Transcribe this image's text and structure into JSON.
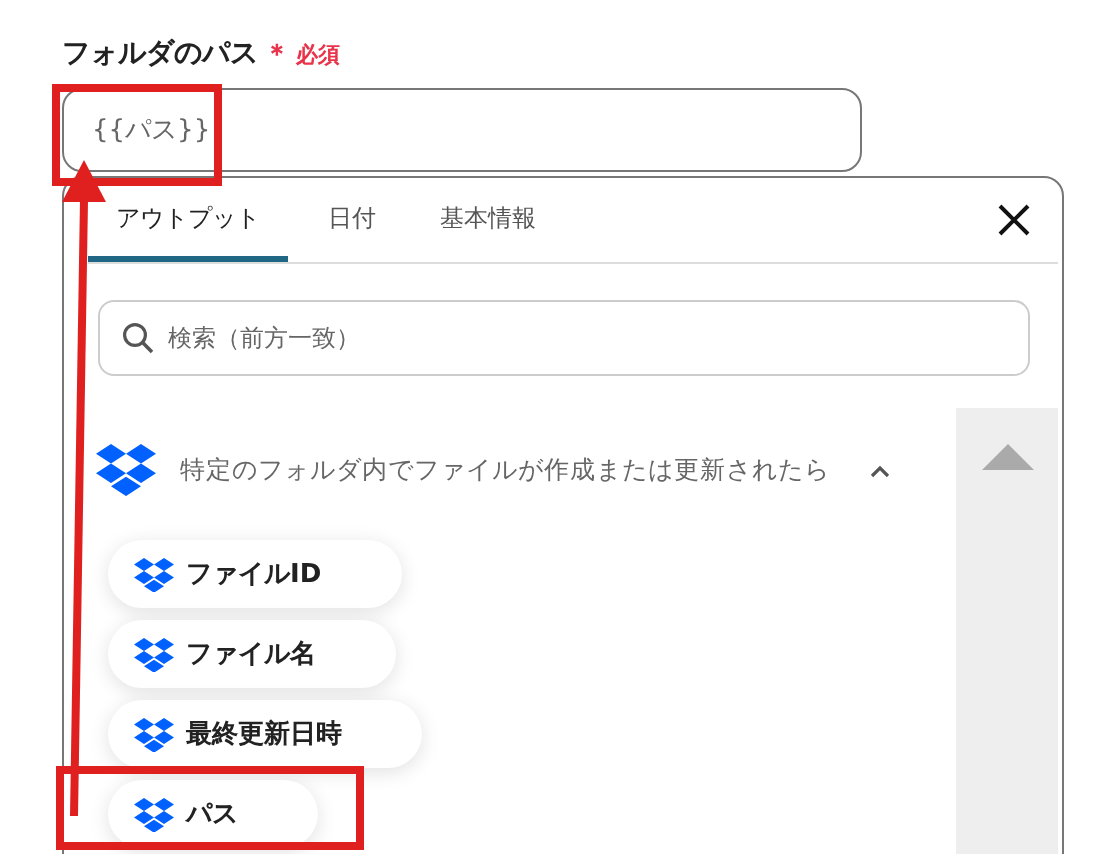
{
  "field": {
    "label": "フォルダのパス",
    "required_mark": "＊",
    "required_text": "必須",
    "value": "{{パス}}"
  },
  "tabs": [
    {
      "label": "アウトプット",
      "selected": true
    },
    {
      "label": "日付",
      "selected": false
    },
    {
      "label": "基本情報",
      "selected": false
    }
  ],
  "search": {
    "placeholder": "検索（前方一致）"
  },
  "section": {
    "title": "特定のフォルダ内でファイルが作成または更新されたら",
    "expanded": true,
    "items": [
      {
        "label": "ファイルID"
      },
      {
        "label": "ファイル名"
      },
      {
        "label": "最終更新日時"
      },
      {
        "label": "パス"
      }
    ]
  }
}
